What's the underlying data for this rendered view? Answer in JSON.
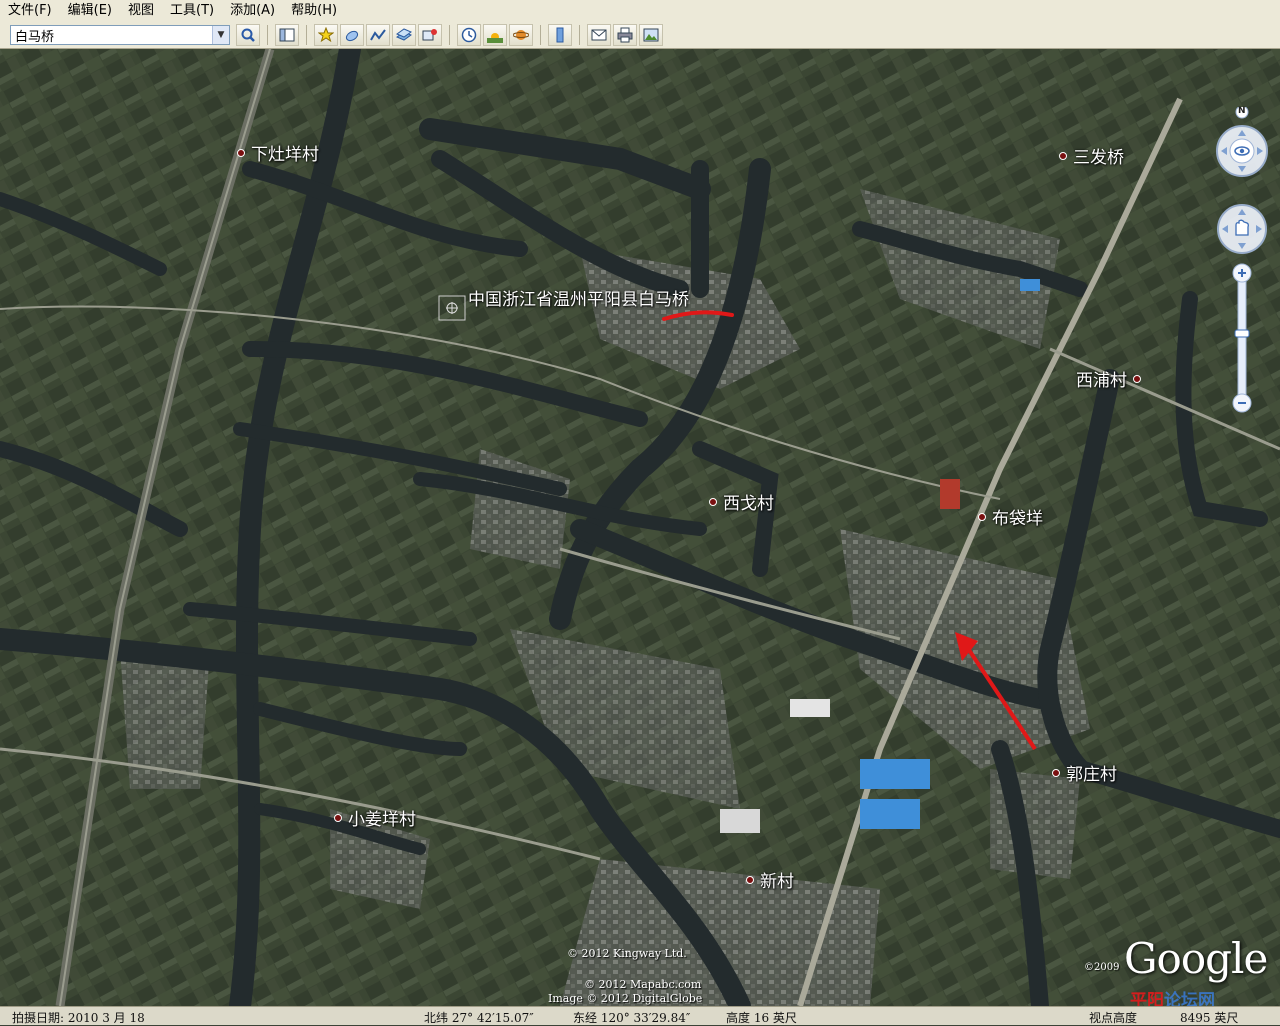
{
  "menu": [
    "文件(F)",
    "编辑(E)",
    "视图",
    "工具(T)",
    "添加(A)",
    "帮助(H)"
  ],
  "search": {
    "value": "白马桥"
  },
  "toolbar_icons": [
    "search-icon",
    "sidebar-icon",
    "placemark-icon",
    "polygon-icon",
    "path-icon",
    "overlay-icon",
    "tour-icon",
    "historical-imagery-icon",
    "sunlight-icon",
    "planets-icon",
    "ruler-icon",
    "email-icon",
    "print-icon",
    "save-image-icon"
  ],
  "map": {
    "main_label": "中国浙江省温州平阳县白马桥",
    "places": [
      "下灶垟村",
      "三发桥",
      "西浦村",
      "西戈村",
      "布袋垟",
      "郭庄村",
      "小姜垟村",
      "新村"
    ],
    "compass_north": "N",
    "credits": [
      "© 2012 Kingway Ltd.",
      "© 2012 Mapabc.com",
      "Image © 2012 DigitalGlobe"
    ],
    "logo_year": "©2009",
    "logo": "Google",
    "watermark": "平阳",
    "watermark2": "论坛网"
  },
  "status": {
    "date_label": "拍摄日期: 2010 3 月 18",
    "lat": "北纬 27° 42′15.07″",
    "lon": "东经 120° 33′29.84″",
    "elev": "高度    16 英尺",
    "eye": "视点高度",
    "eye_value": "8495 英尺"
  },
  "colors": {
    "water": "#232b2d",
    "land": "#3b4633",
    "marker": "#7a1010",
    "arrow": "#e01818"
  }
}
